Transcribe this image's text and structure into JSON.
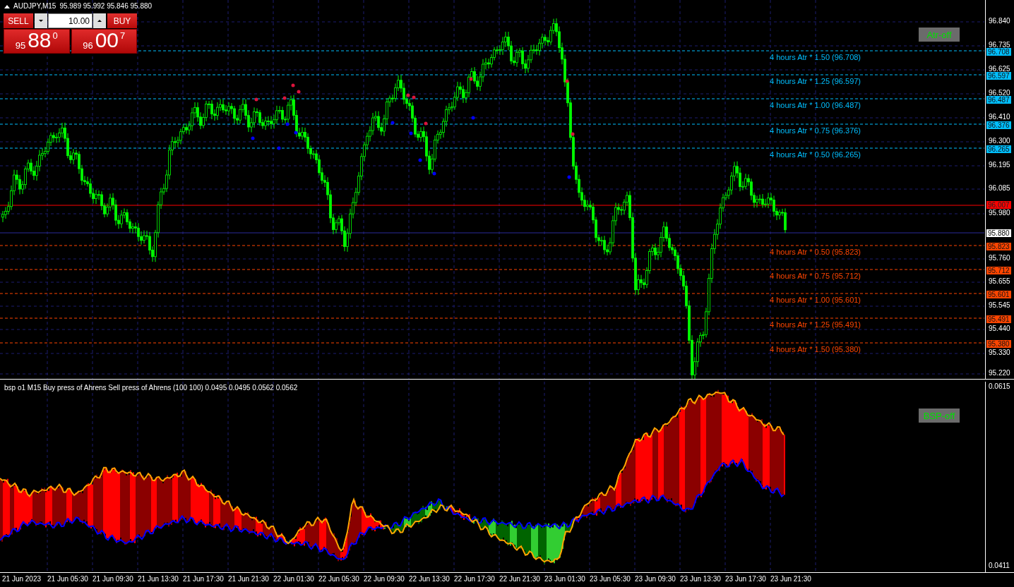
{
  "chart": {
    "symbol": "AUDJPY,M15",
    "ohlc": "95.989 95.992 95.846 95.880",
    "toggle_button": "Atr-off"
  },
  "trade_panel": {
    "sell_label": "SELL",
    "buy_label": "BUY",
    "volume": "10.00",
    "sell_price": {
      "prefix": "95",
      "big": "88",
      "sup": "0"
    },
    "buy_price": {
      "prefix": "96",
      "big": "00",
      "sup": "7"
    }
  },
  "atr_levels": [
    {
      "label": "4 hours Atr * 1.50 (96.708)",
      "tag": "96.708",
      "color": "#00bfff"
    },
    {
      "label": "4 hours Atr * 1.25 (96.597)",
      "tag": "96.597",
      "color": "#00bfff"
    },
    {
      "label": "4 hours Atr * 1.00 (96.487)",
      "tag": "96.487",
      "color": "#00bfff"
    },
    {
      "label": "4 hours Atr * 0.75 (96.376)",
      "tag": "96.376",
      "color": "#00bfff"
    },
    {
      "label": "4 hours Atr * 0.50 (96.265)",
      "tag": "96.265",
      "color": "#00bfff"
    },
    {
      "label": "4 hours Atr * 0.50 (95.823)",
      "tag": "95.823",
      "color": "#ff4500"
    },
    {
      "label": "4 hours Atr * 0.75 (95.712)",
      "tag": "95.712",
      "color": "#ff4500"
    },
    {
      "label": "4 hours Atr * 1.00 (95.601)",
      "tag": "95.601",
      "color": "#ff4500"
    },
    {
      "label": "4 hours Atr * 1.25 (95.491)",
      "tag": "95.491",
      "color": "#ff4500"
    },
    {
      "label": "4 hours Atr * 1.50 (95.380)",
      "tag": "95.380",
      "color": "#ff4500"
    }
  ],
  "price_axis": {
    "ticks": [
      "96.840",
      "96.735",
      "96.625",
      "96.520",
      "96.410",
      "96.300",
      "96.195",
      "96.085",
      "95.980",
      "95.760",
      "95.655",
      "95.545",
      "95.440",
      "95.330",
      "95.220"
    ],
    "ask_tag": "96.007",
    "bid_tag": "95.880"
  },
  "indicator": {
    "title": "bsp o1 M15 Buy press of Ahrens Sell press of Ahrens (100 100) 0.0495 0.0495 0.0562 0.0562",
    "toggle_button": "BSP-off",
    "axis_max": "0.0615",
    "axis_min": "0.0411"
  },
  "time_axis": [
    "21 Jun 2023",
    "21 Jun 05:30",
    "21 Jun 09:30",
    "21 Jun 13:30",
    "21 Jun 17:30",
    "21 Jun 21:30",
    "22 Jun 01:30",
    "22 Jun 05:30",
    "22 Jun 09:30",
    "22 Jun 13:30",
    "22 Jun 17:30",
    "22 Jun 21:30",
    "23 Jun 01:30",
    "23 Jun 05:30",
    "23 Jun 09:30",
    "23 Jun 13:30",
    "23 Jun 17:30",
    "23 Jun 21:30"
  ]
}
